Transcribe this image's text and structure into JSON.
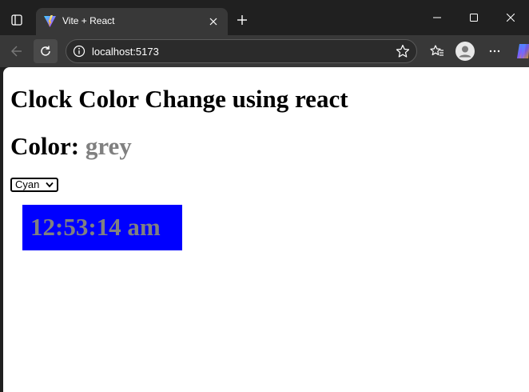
{
  "browser": {
    "tab": {
      "title": "Vite + React",
      "favicon": "vite-logo-icon"
    },
    "address_bar": {
      "url": "localhost:5173",
      "info_icon": "info-icon",
      "favorite_icon": "star-icon"
    },
    "toolbar_icons": [
      "back-arrow-icon",
      "refresh-icon",
      "favorites-icon",
      "profile-icon",
      "more-icon",
      "copilot-icon"
    ],
    "window_controls": [
      "minimize-icon",
      "maximize-icon",
      "close-icon"
    ]
  },
  "page": {
    "title": "Clock Color Change using react",
    "color_heading": {
      "label": "Color: ",
      "value": "grey",
      "value_color": "#808080"
    },
    "color_select": {
      "selected": "Cyan"
    },
    "clock": {
      "time": "12:53:14 am",
      "background": "#0000ff",
      "text_color": "#808080"
    }
  }
}
